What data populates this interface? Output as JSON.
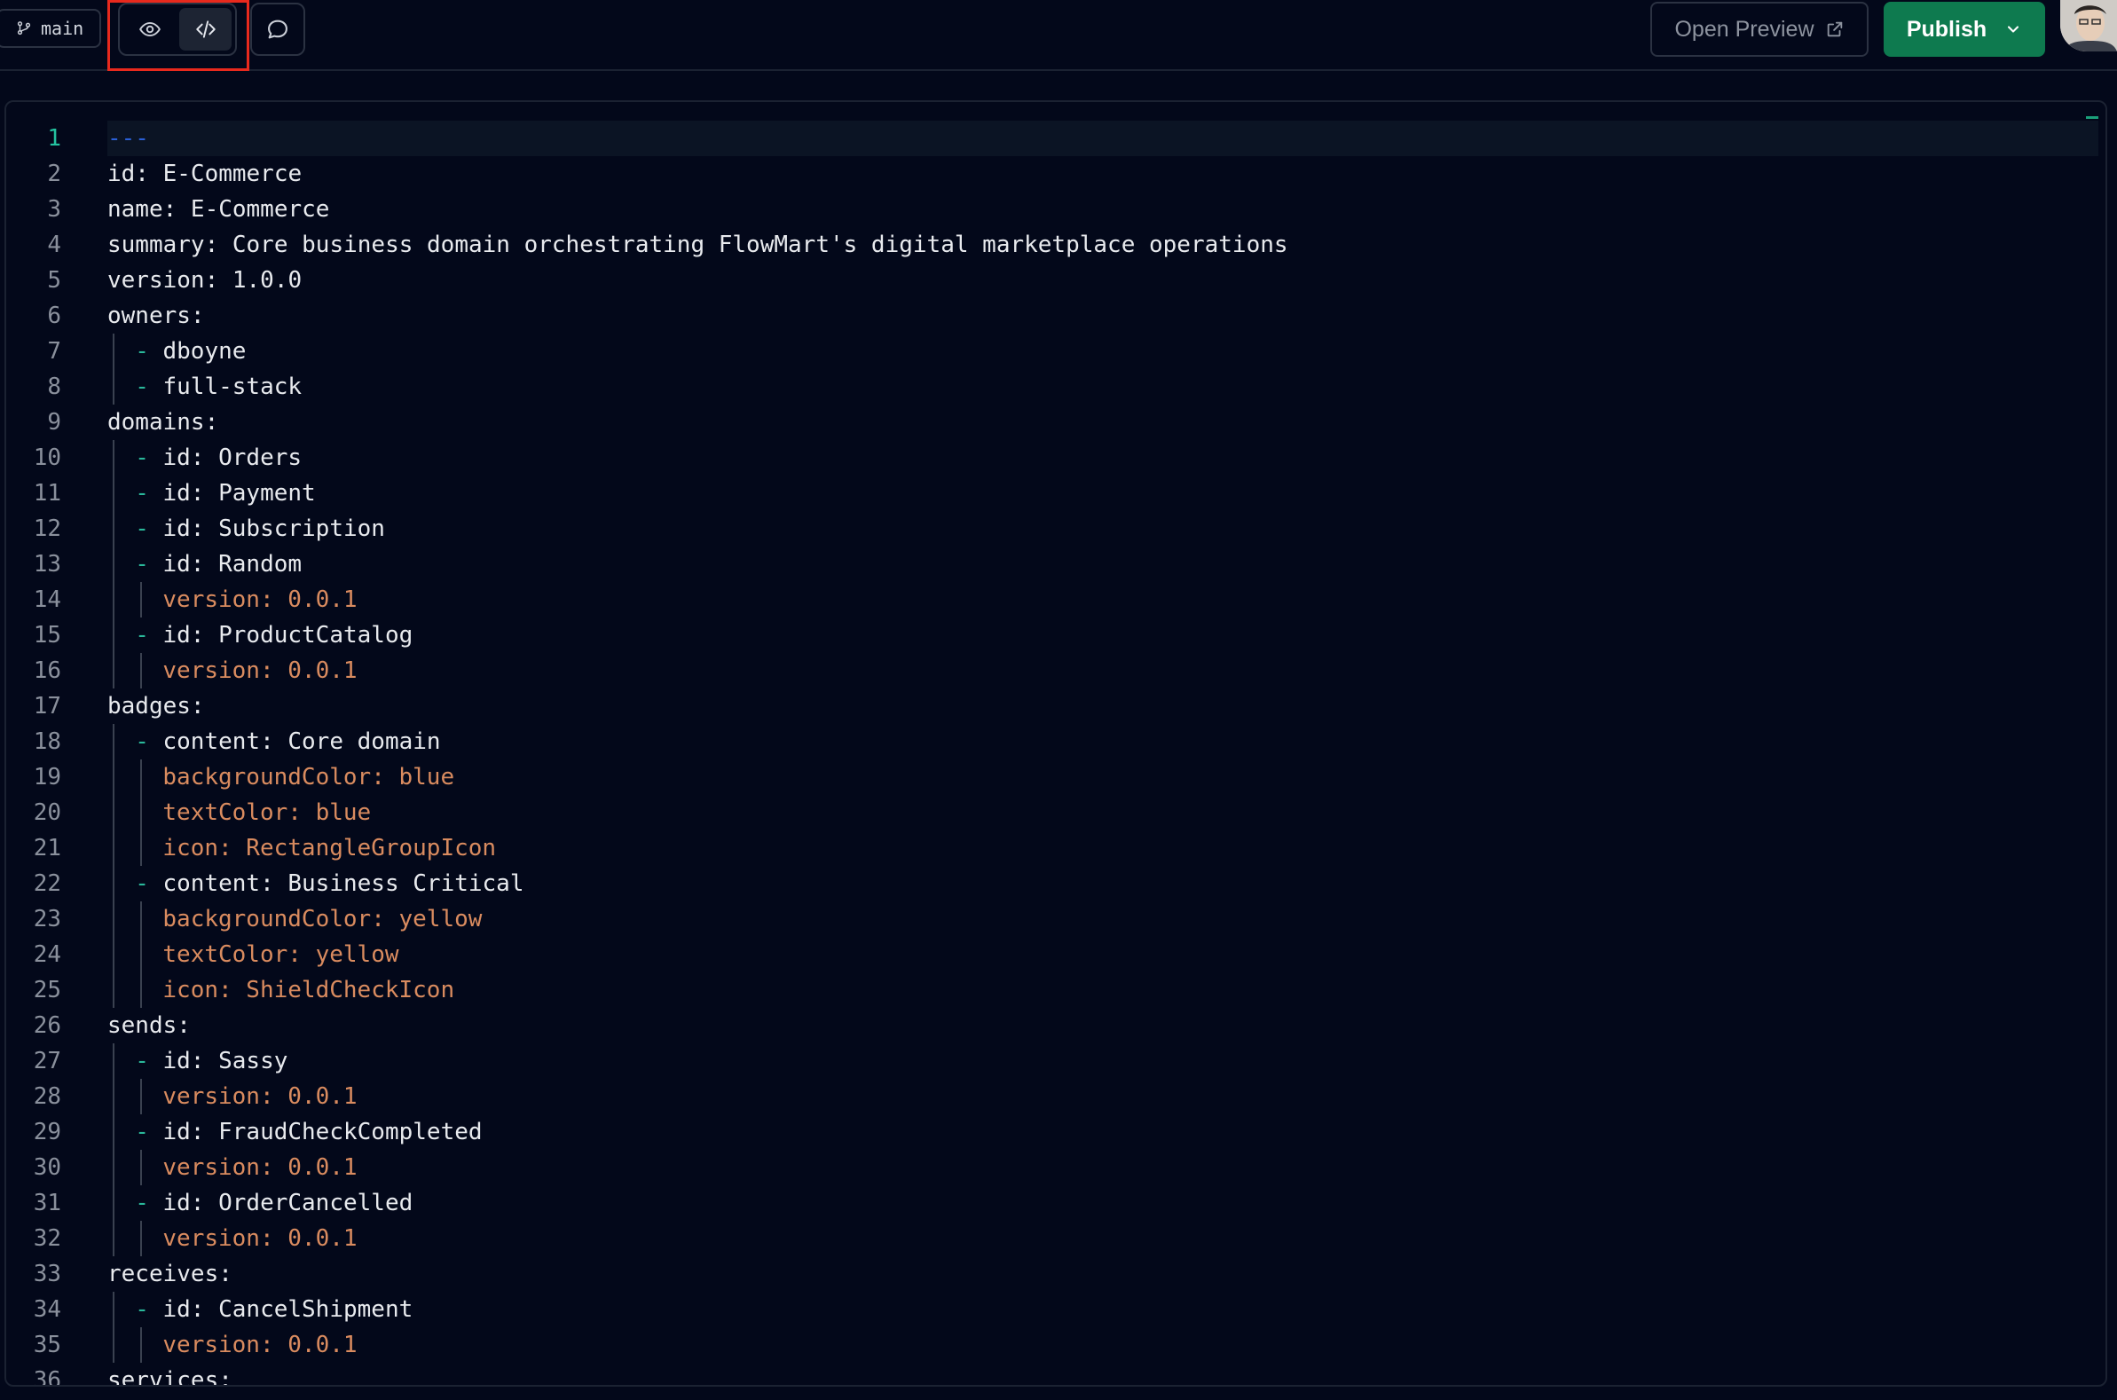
{
  "header": {
    "branch_label": "main",
    "open_preview_label": "Open Preview",
    "publish_label": "Publish"
  },
  "editor": {
    "current_line": 1,
    "lines": [
      {
        "n": "1",
        "indent": 0,
        "parts": [
          {
            "t": "---",
            "c": "c-sep"
          }
        ]
      },
      {
        "n": "2",
        "indent": 0,
        "parts": [
          {
            "t": "id: E-Commerce",
            "c": "c-key"
          }
        ]
      },
      {
        "n": "3",
        "indent": 0,
        "parts": [
          {
            "t": "name: E-Commerce",
            "c": "c-key"
          }
        ]
      },
      {
        "n": "4",
        "indent": 0,
        "parts": [
          {
            "t": "summary: Core business domain orchestrating FlowMart's digital marketplace operations",
            "c": "c-key"
          }
        ]
      },
      {
        "n": "5",
        "indent": 0,
        "parts": [
          {
            "t": "version: 1.0.0",
            "c": "c-key"
          }
        ]
      },
      {
        "n": "6",
        "indent": 0,
        "parts": [
          {
            "t": "owners:",
            "c": "c-key"
          }
        ]
      },
      {
        "n": "7",
        "indent": 1,
        "parts": [
          {
            "t": "- ",
            "c": "c-dash"
          },
          {
            "t": "dboyne",
            "c": "c-key"
          }
        ]
      },
      {
        "n": "8",
        "indent": 1,
        "parts": [
          {
            "t": "- ",
            "c": "c-dash"
          },
          {
            "t": "full-stack",
            "c": "c-key"
          }
        ]
      },
      {
        "n": "9",
        "indent": 0,
        "parts": [
          {
            "t": "domains:",
            "c": "c-key"
          }
        ]
      },
      {
        "n": "10",
        "indent": 1,
        "parts": [
          {
            "t": "- ",
            "c": "c-dash"
          },
          {
            "t": "id: Orders",
            "c": "c-key"
          }
        ]
      },
      {
        "n": "11",
        "indent": 1,
        "parts": [
          {
            "t": "- ",
            "c": "c-dash"
          },
          {
            "t": "id: Payment",
            "c": "c-key"
          }
        ]
      },
      {
        "n": "12",
        "indent": 1,
        "parts": [
          {
            "t": "- ",
            "c": "c-dash"
          },
          {
            "t": "id: Subscription",
            "c": "c-key"
          }
        ]
      },
      {
        "n": "13",
        "indent": 1,
        "parts": [
          {
            "t": "- ",
            "c": "c-dash"
          },
          {
            "t": "id: Random",
            "c": "c-key"
          }
        ]
      },
      {
        "n": "14",
        "indent": 2,
        "parts": [
          {
            "t": "version: 0.0.1",
            "c": "c-orange"
          }
        ]
      },
      {
        "n": "15",
        "indent": 1,
        "parts": [
          {
            "t": "- ",
            "c": "c-dash"
          },
          {
            "t": "id: ProductCatalog",
            "c": "c-key"
          }
        ]
      },
      {
        "n": "16",
        "indent": 2,
        "parts": [
          {
            "t": "version: 0.0.1",
            "c": "c-orange"
          }
        ]
      },
      {
        "n": "17",
        "indent": 0,
        "parts": [
          {
            "t": "badges:",
            "c": "c-key"
          }
        ]
      },
      {
        "n": "18",
        "indent": 1,
        "parts": [
          {
            "t": "- ",
            "c": "c-dash"
          },
          {
            "t": "content: Core domain",
            "c": "c-key"
          }
        ]
      },
      {
        "n": "19",
        "indent": 2,
        "parts": [
          {
            "t": "backgroundColor: blue",
            "c": "c-orange"
          }
        ]
      },
      {
        "n": "20",
        "indent": 2,
        "parts": [
          {
            "t": "textColor: blue",
            "c": "c-orange"
          }
        ]
      },
      {
        "n": "21",
        "indent": 2,
        "parts": [
          {
            "t": "icon: RectangleGroupIcon",
            "c": "c-orange"
          }
        ]
      },
      {
        "n": "22",
        "indent": 1,
        "parts": [
          {
            "t": "- ",
            "c": "c-dash"
          },
          {
            "t": "content: Business Critical",
            "c": "c-key"
          }
        ]
      },
      {
        "n": "23",
        "indent": 2,
        "parts": [
          {
            "t": "backgroundColor: yellow",
            "c": "c-orange"
          }
        ]
      },
      {
        "n": "24",
        "indent": 2,
        "parts": [
          {
            "t": "textColor: yellow",
            "c": "c-orange"
          }
        ]
      },
      {
        "n": "25",
        "indent": 2,
        "parts": [
          {
            "t": "icon: ShieldCheckIcon",
            "c": "c-orange"
          }
        ]
      },
      {
        "n": "26",
        "indent": 0,
        "parts": [
          {
            "t": "sends:",
            "c": "c-key"
          }
        ]
      },
      {
        "n": "27",
        "indent": 1,
        "parts": [
          {
            "t": "- ",
            "c": "c-dash"
          },
          {
            "t": "id: Sassy",
            "c": "c-key"
          }
        ]
      },
      {
        "n": "28",
        "indent": 2,
        "parts": [
          {
            "t": "version: 0.0.1",
            "c": "c-orange"
          }
        ]
      },
      {
        "n": "29",
        "indent": 1,
        "parts": [
          {
            "t": "- ",
            "c": "c-dash"
          },
          {
            "t": "id: FraudCheckCompleted",
            "c": "c-key"
          }
        ]
      },
      {
        "n": "30",
        "indent": 2,
        "parts": [
          {
            "t": "version: 0.0.1",
            "c": "c-orange"
          }
        ]
      },
      {
        "n": "31",
        "indent": 1,
        "parts": [
          {
            "t": "- ",
            "c": "c-dash"
          },
          {
            "t": "id: OrderCancelled",
            "c": "c-key"
          }
        ]
      },
      {
        "n": "32",
        "indent": 2,
        "parts": [
          {
            "t": "version: 0.0.1",
            "c": "c-orange"
          }
        ]
      },
      {
        "n": "33",
        "indent": 0,
        "parts": [
          {
            "t": "receives:",
            "c": "c-key"
          }
        ]
      },
      {
        "n": "34",
        "indent": 1,
        "parts": [
          {
            "t": "- ",
            "c": "c-dash"
          },
          {
            "t": "id: CancelShipment",
            "c": "c-key"
          }
        ]
      },
      {
        "n": "35",
        "indent": 2,
        "parts": [
          {
            "t": "version: 0.0.1",
            "c": "c-orange"
          }
        ]
      },
      {
        "n": "36",
        "indent": 0,
        "parts": [
          {
            "t": "services:",
            "c": "c-key"
          }
        ]
      }
    ]
  }
}
